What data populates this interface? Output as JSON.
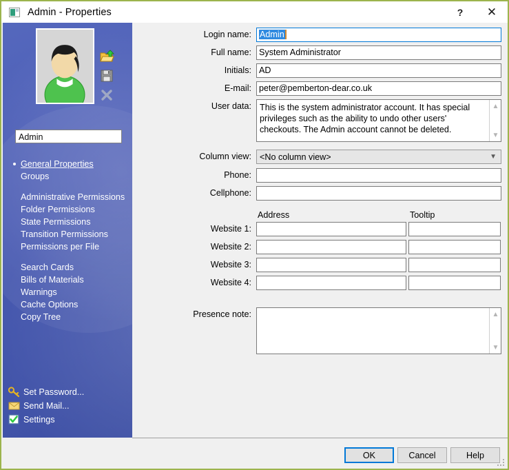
{
  "window": {
    "title": "Admin - Properties",
    "icon": "app-icon",
    "help_button": "?",
    "close_button": "✕",
    "accent_border": "#9cb44d"
  },
  "sidebar": {
    "avatar_alt": "user-avatar",
    "name_value": "Admin",
    "tools": [
      {
        "name": "open-folder-icon",
        "title": "Open"
      },
      {
        "name": "save-icon",
        "title": "Save"
      },
      {
        "name": "delete-icon",
        "title": "Delete"
      }
    ],
    "nav_groups": [
      {
        "items": [
          {
            "label": "General Properties",
            "selected": true
          },
          {
            "label": "Groups",
            "selected": false
          }
        ]
      },
      {
        "items": [
          {
            "label": "Administrative Permissions",
            "selected": false
          },
          {
            "label": "Folder Permissions",
            "selected": false
          },
          {
            "label": "State Permissions",
            "selected": false
          },
          {
            "label": "Transition Permissions",
            "selected": false
          },
          {
            "label": "Permissions per File",
            "selected": false
          }
        ]
      },
      {
        "items": [
          {
            "label": "Search Cards",
            "selected": false
          },
          {
            "label": "Bills of Materials",
            "selected": false
          },
          {
            "label": "Warnings",
            "selected": false
          },
          {
            "label": "Cache Options",
            "selected": false
          },
          {
            "label": "Copy Tree",
            "selected": false
          }
        ]
      }
    ],
    "bottom_links": [
      {
        "label": "Set Password...",
        "icon": "key-icon"
      },
      {
        "label": "Send Mail...",
        "icon": "mail-icon"
      },
      {
        "label": "Settings",
        "icon": "settings-check-icon"
      }
    ],
    "background_color": "#4a5bb4"
  },
  "form": {
    "login_name": {
      "label": "Login name:",
      "value": "Admin",
      "selected": true
    },
    "full_name": {
      "label": "Full name:",
      "value": "System Administrator"
    },
    "initials": {
      "label": "Initials:",
      "value": "AD"
    },
    "email": {
      "label": "E-mail:",
      "value": "peter@pemberton-dear.co.uk"
    },
    "user_data": {
      "label": "User data:",
      "value": "This is the system administrator account. It has special privileges such as the ability to undo other users' checkouts. The Admin account cannot be deleted."
    },
    "column_view": {
      "label": "Column view:",
      "value": "<No column view>",
      "options": [
        "<No column view>"
      ]
    },
    "phone": {
      "label": "Phone:",
      "value": ""
    },
    "cellphone": {
      "label": "Cellphone:",
      "value": ""
    },
    "website_headers": {
      "address": "Address",
      "tooltip": "Tooltip"
    },
    "websites": [
      {
        "label": "Website 1:",
        "address": "",
        "tooltip": ""
      },
      {
        "label": "Website 2:",
        "address": "",
        "tooltip": ""
      },
      {
        "label": "Website 3:",
        "address": "",
        "tooltip": ""
      },
      {
        "label": "Website 4:",
        "address": "",
        "tooltip": ""
      }
    ],
    "presence_note": {
      "label": "Presence note:",
      "value": ""
    }
  },
  "footer": {
    "ok": "OK",
    "cancel": "Cancel",
    "help": "Help"
  }
}
